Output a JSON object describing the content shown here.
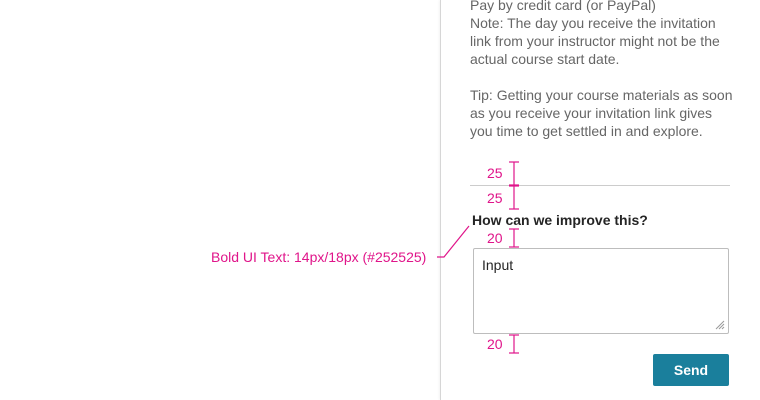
{
  "panel": {
    "paragraphs": [
      "Pay by credit card (or PayPal)",
      "Note: The day you receive the invitation link from your instructor might not be the actual course start date.",
      "Tip: Getting your course materials as soon as you receive your invitation link gives you time to get settled in and explore."
    ],
    "question": "How can we improve this?",
    "input_value": "Input",
    "send_label": "Send"
  },
  "annotations": {
    "spacing": [
      "25",
      "25",
      "20",
      "20"
    ],
    "text_style_callout": "Bold UI Text: 14px/18px (#252525)"
  },
  "colors": {
    "annotation": "#e0158a",
    "button": "#1a7f9c",
    "bold_text": "#252525",
    "body_text": "#666666"
  }
}
